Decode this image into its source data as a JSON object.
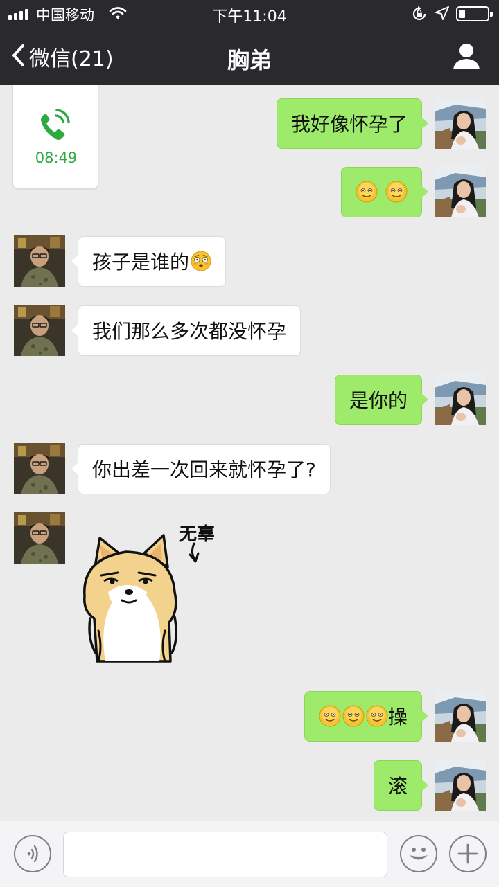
{
  "status_bar": {
    "carrier": "中国移动",
    "time": "下午11:04",
    "icons": [
      "signal-bars-icon",
      "wifi-icon",
      "rotation-lock-icon",
      "location-arrow-icon",
      "battery-icon"
    ],
    "battery_level": 0.2
  },
  "nav": {
    "back_label": "微信(21)",
    "title": "胸弟",
    "right_icon": "contact-profile-icon",
    "background": "#2a2a2e"
  },
  "colors": {
    "chat_background": "#ebebeb",
    "outgoing_bubble": "#9eea6a",
    "incoming_bubble": "#ffffff",
    "call_green": "#2eaa40"
  },
  "messages": [
    {
      "side": "left",
      "type": "voice-call",
      "duration": "08:49",
      "icon": "phone-call-icon"
    },
    {
      "side": "right",
      "type": "text",
      "text": "我好像怀孕了"
    },
    {
      "side": "right",
      "type": "emoji",
      "emojis": [
        "smile-emoji",
        "smile-emoji"
      ]
    },
    {
      "side": "left",
      "type": "text",
      "text": "孩子是谁的",
      "emojis": [
        "shocked-emoji"
      ]
    },
    {
      "side": "left",
      "type": "text",
      "text": "我们那么多次都没怀孕"
    },
    {
      "side": "right",
      "type": "text",
      "text": "是你的"
    },
    {
      "side": "left",
      "type": "text",
      "text": "你出差一次回来就怀孕了?"
    },
    {
      "side": "left",
      "type": "sticker",
      "sticker_text": "无辜",
      "sticker": "shiba-dog-sticker"
    },
    {
      "side": "right",
      "type": "text",
      "text": "操",
      "emojis": [
        "smile-emoji",
        "smile-emoji",
        "smile-emoji"
      ]
    },
    {
      "side": "right",
      "type": "text",
      "text": "滚"
    }
  ],
  "input_bar": {
    "voice_icon": "voice-input-icon",
    "emoji_icon": "emoji-face-icon",
    "plus_icon": "plus-icon",
    "input_value": ""
  }
}
